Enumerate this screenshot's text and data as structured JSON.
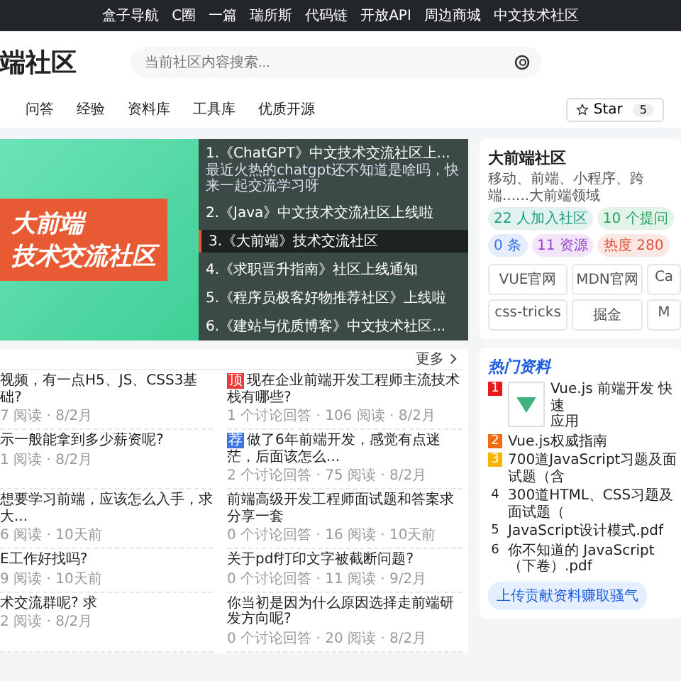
{
  "top_links": [
    "盒子导航",
    "C圈",
    "一篇",
    "瑞所斯",
    "代码链",
    "开放API",
    "周边商城",
    "中文技术社区"
  ],
  "logo": "端社区",
  "search": {
    "placeholder": "当前社区内容搜索..."
  },
  "nav": [
    "问答",
    "经验",
    "资料库",
    "工具库",
    "优质开源"
  ],
  "star": {
    "label": "Star",
    "count": "5"
  },
  "banner": {
    "title": "大前端",
    "subtitle": "技术交流社区",
    "items": [
      {
        "title": "1.《ChatGPT》中文技术交流社区上...",
        "desc": "最近火热的chatgpt还不知道是啥吗，快来一起交流学习呀",
        "selected": false
      },
      {
        "title": "2.《Java》中文技术交流社区上线啦",
        "selected": false
      },
      {
        "title": "3.《大前端》技术交流社区",
        "selected": true
      },
      {
        "title": "4.《求职晋升指南》社区上线通知",
        "selected": false
      },
      {
        "title": "5.《程序员极客好物推荐社区》上线啦",
        "selected": false
      },
      {
        "title": "6.《建站与优质博客》中文技术社区...",
        "selected": false
      }
    ]
  },
  "more": "更多",
  "questions": [
    [
      {
        "title": "视频，有一点H5、JS、CSS3基础?",
        "meta": "7 阅读 · 8/2月"
      },
      {
        "tag": "顶",
        "color": "#e8393c",
        "title": "现在企业前端开发工程师主流技术栈有哪些?",
        "meta": "1 个讨论回答 · 106 阅读 · 8/2月"
      }
    ],
    [
      {
        "title": "示一般能拿到多少薪资呢?",
        "meta": "1 阅读 · 8/2月"
      },
      {
        "tag": "荐",
        "color": "#3a74e0",
        "title": "做了6年前端开发，感觉有点迷茫，后面该怎么...",
        "meta": "2 个讨论回答 · 75 阅读 · 8/2月"
      }
    ],
    [
      {
        "title": "想要学习前端，应该怎么入手，求大...",
        "meta": "6 阅读 · 10天前"
      },
      {
        "title": "前端高级开发工程师面试题和答案求分享一套",
        "meta": "0 个讨论回答 · 16 阅读 · 10天前"
      }
    ],
    [
      {
        "title": "E工作好找吗?",
        "meta": "9 阅读 · 10天前"
      },
      {
        "title": "关于pdf打印文字被截断问题?",
        "meta": "0 个讨论回答 · 11 阅读 · 9/2月"
      }
    ],
    [
      {
        "title": "术交流群呢? 求",
        "meta": "2 阅读 · 8/2月"
      },
      {
        "title": "你当初是因为什么原因选择走前端研发方向呢?",
        "meta": "0 个讨论回答 · 20 阅读 · 8/2月"
      }
    ]
  ],
  "community": {
    "name": "大前端社区",
    "desc": "移动、前端、小程序、跨端......大前端领域",
    "tags": [
      {
        "text": "22 人加入社区",
        "color": "#1f9e84"
      },
      {
        "text": "10 个提问",
        "color": "#25a35a"
      },
      {
        "text": "0 条",
        "color": "#3a74e0"
      },
      {
        "text": "11 资源",
        "color": "#9b3fd0"
      },
      {
        "text": "热度 280",
        "color": "#e0553a"
      }
    ],
    "links": [
      "VUE官网",
      "MDN官网",
      "Ca",
      "css-tricks",
      "掘金",
      "M"
    ]
  },
  "hot": {
    "title": "热门资料",
    "items": [
      {
        "rank": "1",
        "kind": "ribbon",
        "color": "#e8191c",
        "title": "Vue.js 前端开发 快速",
        "title2": "应用",
        "thumb": true
      },
      {
        "rank": "2",
        "kind": "ribbon",
        "color": "#f06a0f",
        "title": "Vue.js权威指南"
      },
      {
        "rank": "3",
        "kind": "ribbon",
        "color": "#f7b500",
        "title": "700道JavaScript习题及面试题（含"
      },
      {
        "rank": "4",
        "kind": "plain",
        "title": "300道HTML、CSS习题及面试题（"
      },
      {
        "rank": "5",
        "kind": "plain",
        "title": "JavaScript设计模式.pdf"
      },
      {
        "rank": "6",
        "kind": "plain",
        "title": "你不知道的 JavaScript（下卷）.pdf"
      }
    ],
    "button": "上传贡献资料赚取骚气"
  }
}
